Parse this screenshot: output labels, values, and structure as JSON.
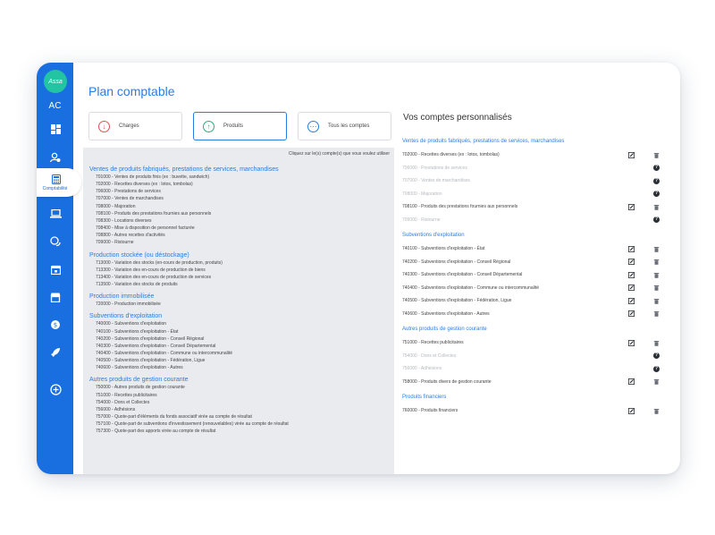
{
  "app": {
    "logo_text": "Assa",
    "user_initials": "AC",
    "active_nav_label": "Comptabilité",
    "accent_color": "#1a6fe0"
  },
  "page": {
    "title": "Plan comptable",
    "filters": [
      {
        "label": "Charges",
        "icon": "arrow-down-icon",
        "color": "#e05050"
      },
      {
        "label": "Produits",
        "icon": "arrow-up-icon",
        "color": "#22b07d",
        "active": true
      },
      {
        "label": "Tous les comptes",
        "icon": "more-dots-icon",
        "color": "#2a7de1"
      }
    ],
    "hint": "Cliquez sur le(s) compte(s) que vous voulez utiliser"
  },
  "left": {
    "groups": [
      {
        "title": "Ventes de produits fabriqués, prestations de services, marchandises",
        "items": [
          "701000 - Ventes de produits finis (ex : buvette, sandwich)",
          "702000 - Recettes diverses (ex : lotos, tombolas)",
          "706000 - Prestations de services",
          "707000 - Ventes de marchandises",
          "708000 - Majoration",
          "708100 - Produits des prestations fournies aux personnels",
          "708300 - Locations diverses",
          "708400 - Mise à disposition de personnel facturée",
          "708800 - Autres recettes d'activités",
          "709000 - Ristourne"
        ]
      },
      {
        "title": "Production stockée (ou déstockage)",
        "items": [
          "713000 - Variation des stocks (en-cours de production, produits)",
          "713300 - Variation des en-cours de production de biens",
          "713400 - Variation des en-cours de production de services",
          "713500 - Variation des stocks de produits"
        ]
      },
      {
        "title": "Production immobilisée",
        "items": [
          "720000 - Production immobilisée"
        ]
      },
      {
        "title": "Subventions d'exploitation",
        "items": [
          "740000 - Subventions d'exploitation",
          "740100 - Subventions d'exploitation - État",
          "740200 - Subventions d'exploitation - Conseil Régional",
          "740300 - Subventions d'exploitation - Conseil Départemental",
          "740400 - Subventions d'exploitation - Commune ou intercommunalité",
          "740500 - Subventions d'exploitation - Fédération, Ligue",
          "740600 - Subventions d'exploitation - Autres"
        ]
      },
      {
        "title": "Autres produits de gestion courante",
        "items": [
          "750000 - Autres produits de gestion courante",
          "751000 - Recettes publicitaires",
          "754000 - Dons et Collectes",
          "756000 - Adhésions",
          "757000 - Quote-part d'éléments du fonds associatif virée au compte de résultat",
          "757100 - Quote-part de subventions d'investissement (renouvelables) virée au compte de résultat",
          "757300 - Quote-part des apports virée au compte de résultat"
        ]
      }
    ]
  },
  "right": {
    "title": "Vos comptes personnalisés",
    "groups": [
      {
        "title": "Ventes de produits fabriqués, prestations de services, marchandises",
        "rows": [
          {
            "label": "702000 - Recettes diverses (ex : lotos, tombolas)",
            "active": true
          },
          {
            "label": "706000 - Prestations de services",
            "active": false
          },
          {
            "label": "707000 - Ventes de marchandises",
            "active": false
          },
          {
            "label": "708000 - Majoration",
            "active": false
          },
          {
            "label": "708100 - Produits des prestations fournies aux personnels",
            "active": true
          },
          {
            "label": "709000 - Ristourne",
            "active": false
          }
        ]
      },
      {
        "title": "Subventions d'exploitation",
        "rows": [
          {
            "label": "740100 - Subventions d'exploitation - État",
            "active": true
          },
          {
            "label": "740200 - Subventions d'exploitation - Conseil Régional",
            "active": true
          },
          {
            "label": "740300 - Subventions d'exploitation - Conseil Départemental",
            "active": true
          },
          {
            "label": "740400 - Subventions d'exploitation - Commune ou intercommunalité",
            "active": true
          },
          {
            "label": "740500 - Subventions d'exploitation - Fédération, Ligue",
            "active": true
          },
          {
            "label": "740600 - Subventions d'exploitation - Autres",
            "active": true
          }
        ]
      },
      {
        "title": "Autres produits de gestion courante",
        "rows": [
          {
            "label": "751000 - Recettes publicitaires",
            "active": true
          },
          {
            "label": "754000 - Dons et Collectes",
            "active": false
          },
          {
            "label": "756000 - Adhésions",
            "active": false
          },
          {
            "label": "758000 - Produits divers de gestion courante",
            "active": true
          }
        ]
      },
      {
        "title": "Produits financiers",
        "rows": [
          {
            "label": "760000 - Produits financiers",
            "active": true
          }
        ]
      }
    ]
  }
}
